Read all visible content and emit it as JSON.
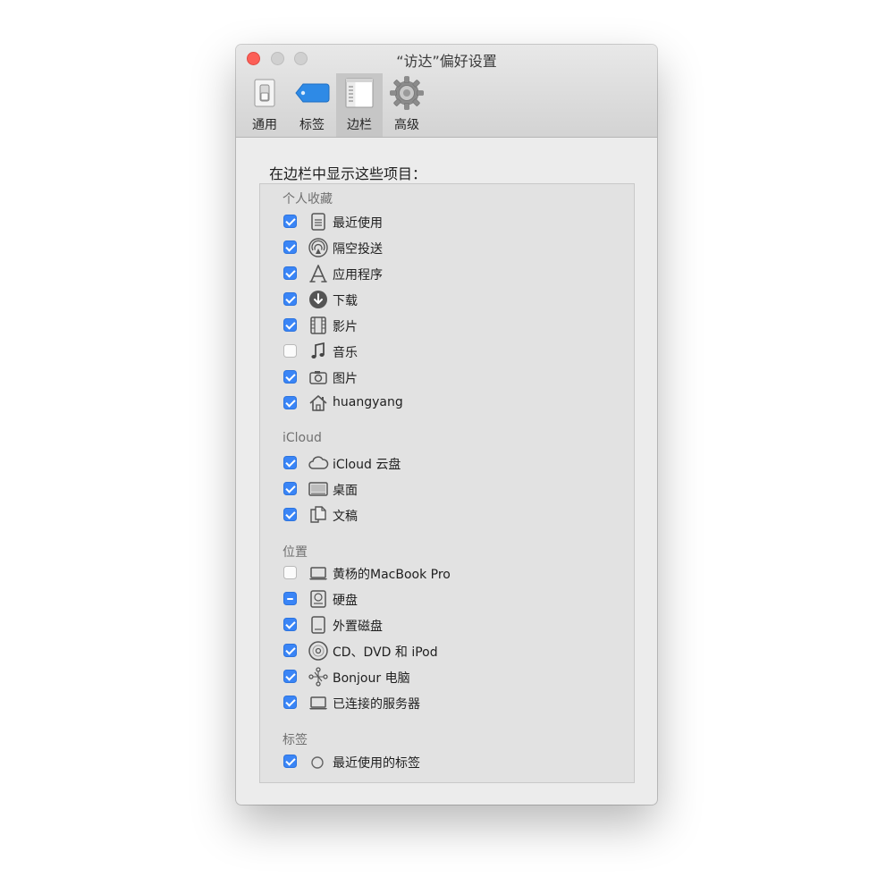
{
  "window": {
    "title": "“访达”偏好设置"
  },
  "toolbar": {
    "tabs": [
      {
        "label": "通用",
        "icon": "switch-icon"
      },
      {
        "label": "标签",
        "icon": "tag-icon"
      },
      {
        "label": "边栏",
        "icon": "sidebar-icon",
        "selected": true
      },
      {
        "label": "高级",
        "icon": "gear-icon"
      }
    ]
  },
  "content": {
    "heading": "在边栏中显示这些项目："
  },
  "sections": {
    "favorites": {
      "header": "个人收藏",
      "items": [
        {
          "label": "最近使用",
          "icon": "recents-icon",
          "state": "checked"
        },
        {
          "label": "隔空投送",
          "icon": "airdrop-icon",
          "state": "checked"
        },
        {
          "label": "应用程序",
          "icon": "applications-icon",
          "state": "checked"
        },
        {
          "label": "下载",
          "icon": "download-icon",
          "state": "checked"
        },
        {
          "label": "影片",
          "icon": "film-icon",
          "state": "checked"
        },
        {
          "label": "音乐",
          "icon": "music-icon",
          "state": "unchecked"
        },
        {
          "label": "图片",
          "icon": "camera-icon",
          "state": "checked"
        },
        {
          "label": "huangyang",
          "icon": "home-icon",
          "state": "checked"
        }
      ]
    },
    "icloud": {
      "header": "iCloud",
      "items": [
        {
          "label": "iCloud 云盘",
          "icon": "cloud-icon",
          "state": "checked"
        },
        {
          "label": "桌面",
          "icon": "desktop-icon",
          "state": "checked"
        },
        {
          "label": "文稿",
          "icon": "documents-icon",
          "state": "checked"
        }
      ]
    },
    "locations": {
      "header": "位置",
      "items": [
        {
          "label": "黄杨的MacBook Pro",
          "icon": "laptop-icon",
          "state": "unchecked"
        },
        {
          "label": "硬盘",
          "icon": "hard-disk-icon",
          "state": "mixed"
        },
        {
          "label": "外置磁盘",
          "icon": "external-disk-icon",
          "state": "checked"
        },
        {
          "label": "CD、DVD 和 iPod",
          "icon": "disc-icon",
          "state": "checked"
        },
        {
          "label": "Bonjour 电脑",
          "icon": "bonjour-icon",
          "state": "checked"
        },
        {
          "label": "已连接的服务器",
          "icon": "server-icon",
          "state": "checked"
        }
      ]
    },
    "tags": {
      "header": "标签",
      "items": [
        {
          "label": "最近使用的标签",
          "icon": "tag-circle-icon",
          "state": "checked"
        }
      ]
    }
  },
  "colors": {
    "accent": "#3a85f6",
    "close": "#fc5f57"
  }
}
